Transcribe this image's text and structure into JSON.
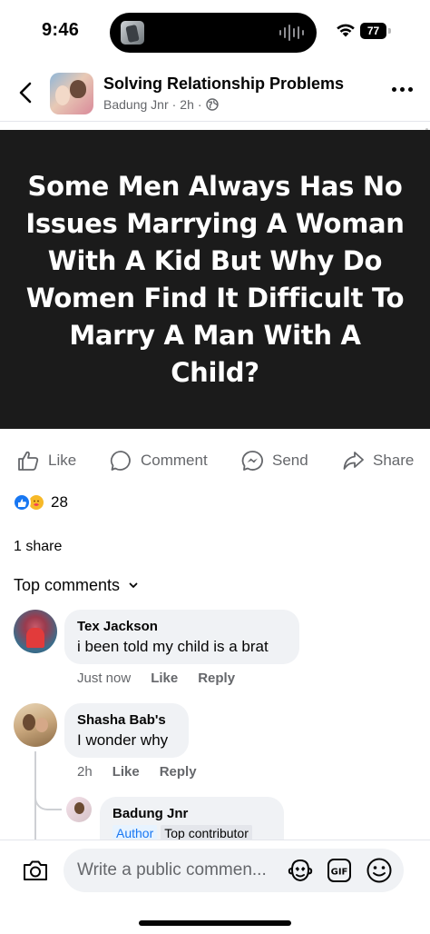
{
  "status_bar": {
    "time": "9:46",
    "battery": "77"
  },
  "header": {
    "page_name": "Solving Relationship Problems",
    "author": "Badung Jnr",
    "time": "2h",
    "separator": "·"
  },
  "post": {
    "image_text": "Some Men Always Has No Issues Marrying A Woman With A Kid But Why Do Women Find It Difficult To Marry A Man With A Child?"
  },
  "actions": {
    "like": "Like",
    "comment": "Comment",
    "send": "Send",
    "share": "Share"
  },
  "reactions": {
    "count": "28",
    "types": [
      "like",
      "care"
    ]
  },
  "shares": "1 share",
  "comments_section": {
    "title": "Top comments"
  },
  "comments": [
    {
      "name": "Tex Jackson",
      "text": "i been told my child is a brat",
      "time": "Just now",
      "like": "Like",
      "reply": "Reply"
    },
    {
      "name": "Shasha Bab's",
      "text": "I wonder why",
      "time": "2h",
      "like": "Like",
      "reply": "Reply"
    }
  ],
  "reply": {
    "name": "Badung Jnr",
    "badge_author": "Author",
    "badge_contributor": "Top contributor"
  },
  "composer": {
    "placeholder": "Write a public commen..."
  },
  "colors": {
    "brand": "#1877f2",
    "post_bg": "#1b1b1b",
    "muted": "#65676b",
    "bubble": "#f0f2f5"
  }
}
